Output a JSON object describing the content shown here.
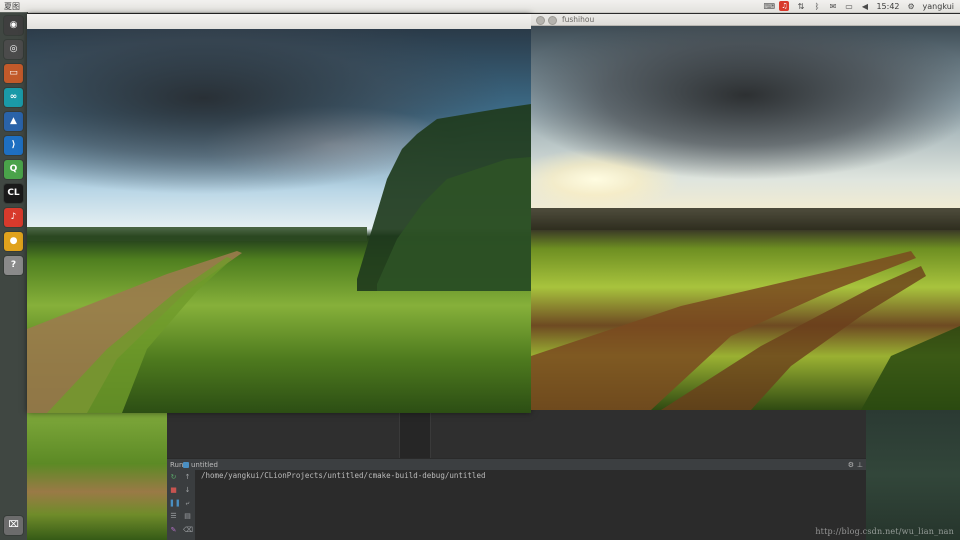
{
  "top_panel": {
    "title": "夏图",
    "time": "15:42",
    "user": "yangkui",
    "tray_icons": [
      "keyboard-icon",
      "netease-music-icon",
      "network-icon",
      "bluetooth-icon",
      "mail-icon",
      "battery-icon",
      "volume-icon"
    ]
  },
  "launcher": {
    "items": [
      {
        "name": "dash-icon",
        "glyph": "◉",
        "color": "#3f3f3f"
      },
      {
        "name": "browser-icon",
        "glyph": "◎",
        "color": "#4b4b4b"
      },
      {
        "name": "files-icon",
        "glyph": "▭",
        "color": "#c25a2a"
      },
      {
        "name": "arduino-icon",
        "glyph": "∞",
        "color": "#1a9aa8"
      },
      {
        "name": "matlab-icon",
        "glyph": "▲",
        "color": "#2a63a8"
      },
      {
        "name": "vscode-icon",
        "glyph": "⟩",
        "color": "#1e6fc1"
      },
      {
        "name": "qt-icon",
        "glyph": "Q",
        "color": "#4aa34a"
      },
      {
        "name": "clion-icon",
        "glyph": "CL",
        "color": "#1a1a1a"
      },
      {
        "name": "netease-music-icon",
        "glyph": "♪",
        "color": "#d83a2c"
      },
      {
        "name": "chrome-icon",
        "glyph": "●",
        "color": "#e0a21c"
      },
      {
        "name": "help-icon",
        "glyph": "?",
        "color": "#8a8a8a"
      }
    ],
    "trash": {
      "name": "trash-icon",
      "glyph": "🗑"
    }
  },
  "right_window": {
    "title": "fushihou"
  },
  "run_panel": {
    "label": "Run",
    "config": "untitled",
    "console_line": "/home/yangkui/CLionProjects/untitled/cmake-build-debug/untitled"
  },
  "watermark": "http://blog.csdn.net/wu_lian_nan"
}
